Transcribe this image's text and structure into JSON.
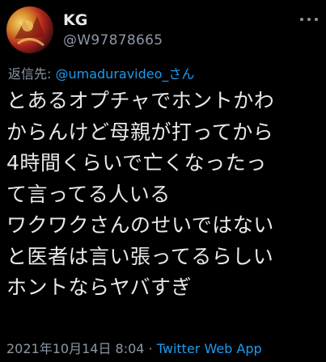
{
  "author": {
    "display_name": "KG",
    "handle": "@W97878665"
  },
  "reply": {
    "prefix": "返信先: ",
    "mention": "@umaduravideo_さん"
  },
  "tweet": {
    "lines": [
      "とあるオプチャでホントかわ",
      "からんけど母親が打ってから",
      "4時間くらいで亡くなったっ",
      "て言ってる人いる",
      "ワクワクさんのせいではない",
      "と医者は言い張ってるらしい",
      "ホントならヤバすぎ"
    ]
  },
  "meta": {
    "timestamp": "2021年10月14日 8:04",
    "separator": " · ",
    "source": "Twitter Web App"
  },
  "icons": {
    "avatar": "avatar-image",
    "more": "more-options-icon"
  },
  "colors": {
    "background": "#000000",
    "text": "#e7e9ea",
    "secondary": "#8b98a5",
    "link": "#1d9bf0"
  }
}
